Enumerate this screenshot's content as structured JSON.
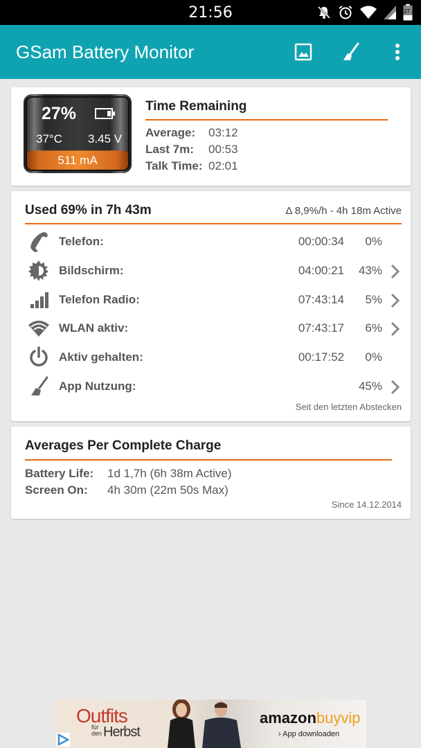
{
  "status_bar": {
    "time": "21:56",
    "battery_level": "27"
  },
  "app_bar": {
    "title": "GSam Battery Monitor"
  },
  "battery_widget": {
    "percent": "27%",
    "temperature": "37°C",
    "voltage": "3.45 V",
    "current": "511 mA",
    "level_fraction": 0.27
  },
  "time_remaining": {
    "heading": "Time Remaining",
    "rows": [
      {
        "label": "Average:",
        "value": "03:12"
      },
      {
        "label": "Last 7m:",
        "value": "00:53"
      },
      {
        "label": "Talk Time:",
        "value": "02:01"
      }
    ]
  },
  "usage": {
    "heading": "Used 69% in 7h 43m",
    "rate": "Δ 8,9%/h - 4h 18m Active",
    "items": [
      {
        "icon": "phone-icon",
        "label": "Telefon:",
        "duration": "00:00:34",
        "percent": "0%",
        "has_chevron": false
      },
      {
        "icon": "brightness-icon",
        "label": "Bildschirm:",
        "duration": "04:00:21",
        "percent": "43%",
        "has_chevron": true
      },
      {
        "icon": "signal-bars-icon",
        "label": "Telefon Radio:",
        "duration": "07:43:14",
        "percent": "5%",
        "has_chevron": true
      },
      {
        "icon": "wifi-icon",
        "label": "WLAN aktiv:",
        "duration": "07:43:17",
        "percent": "6%",
        "has_chevron": true
      },
      {
        "icon": "power-icon",
        "label": "Aktiv gehalten:",
        "duration": "00:17:52",
        "percent": "0%",
        "has_chevron": false
      },
      {
        "icon": "broom-icon",
        "label": "App Nutzung:",
        "duration": "",
        "percent": "45%",
        "has_chevron": true
      }
    ],
    "note": "Seit den letzten Abstecken"
  },
  "averages": {
    "heading": "Averages Per Complete Charge",
    "rows": [
      {
        "label": "Battery Life:",
        "value": "1d 1,7h (6h 38m Active)"
      },
      {
        "label": "Screen On:",
        "value": "4h 30m (22m 50s Max)"
      }
    ],
    "note": "Since 14.12.2014"
  },
  "ad": {
    "headline": "Outfits",
    "small": "für den",
    "season": "Herbst",
    "brand_a": "amazon",
    "brand_b": "buyvip",
    "cta": "› App downloaden"
  },
  "colors": {
    "accent": "#0fa3b1",
    "rule": "#e86a10",
    "background": "#e8e8e8"
  }
}
